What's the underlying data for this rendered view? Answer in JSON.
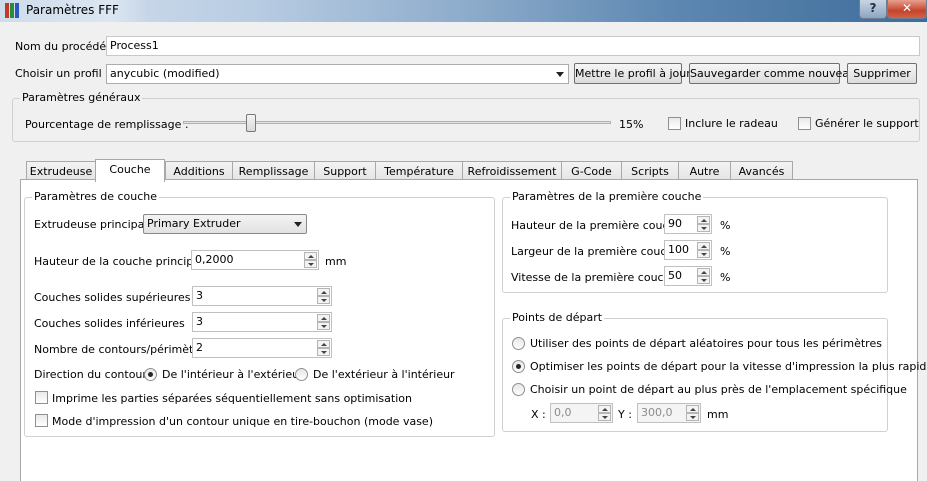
{
  "window": {
    "title": "Paramètres FFF",
    "help_label": "?",
    "close_label": "✕"
  },
  "process": {
    "label": "Nom du procédé :",
    "value": "Process1"
  },
  "profile": {
    "label": "Choisir un profil :",
    "selected": "anycubic (modified)",
    "update_button": "Mettre le profil à jour",
    "save_new_button": "Sauvegarder comme nouveau",
    "delete_button": "Supprimer"
  },
  "general": {
    "title": "Paramètres généraux",
    "infill_label": "Pourcentage de remplissage :",
    "infill_value": "15%",
    "infill_fraction": 0.15,
    "raft_label": "Inclure le radeau",
    "support_label": "Générer le support"
  },
  "tabs": [
    {
      "label": "Extrudeuse"
    },
    {
      "label": "Couche"
    },
    {
      "label": "Additions"
    },
    {
      "label": "Remplissage"
    },
    {
      "label": "Support"
    },
    {
      "label": "Température"
    },
    {
      "label": "Refroidissement"
    },
    {
      "label": "G-Code"
    },
    {
      "label": "Scripts"
    },
    {
      "label": "Autre"
    },
    {
      "label": "Avancés"
    }
  ],
  "active_tab": "Couche",
  "layer": {
    "title": "Paramètres de couche",
    "primary_extruder_label": "Extrudeuse principale",
    "primary_extruder_value": "Primary Extruder",
    "layer_height_label": "Hauteur de la couche principale",
    "layer_height_value": "0,2000",
    "layer_height_unit": "mm",
    "top_layers_label": "Couches solides supérieures",
    "top_layers_value": "3",
    "bottom_layers_label": "Couches solides inférieures",
    "bottom_layers_value": "3",
    "perimeters_label": "Nombre de contours/périmètres",
    "perimeters_value": "2",
    "direction_label": "Direction du contour :",
    "direction_in_out": "De l'intérieur à l'extérieur",
    "direction_out_in": "De l'extérieur à l'intérieur",
    "sequential_label": "Imprime les parties séparées séquentiellement sans optimisation",
    "vase_label": "Mode d'impression d'un contour unique en tire-bouchon (mode vase)"
  },
  "first_layer": {
    "title": "Paramètres de la première couche",
    "height_label": "Hauteur de la première couche",
    "height_value": "90",
    "width_label": "Largeur de la première couche",
    "width_value": "100",
    "speed_label": "Vitesse de la première couche",
    "speed_value": "50",
    "unit": "%"
  },
  "start_points": {
    "title": "Points de départ",
    "random_label": "Utiliser des points de départ aléatoires pour tous les périmètres",
    "optimize_label": "Optimiser les points de départ pour la vitesse d'impression la plus rapide",
    "specific_label": "Choisir un point de départ au plus près de l'emplacement spécifique",
    "x_label": "X :",
    "x_value": "0,0",
    "y_label": "Y :",
    "y_value": "300,0",
    "unit": "mm"
  },
  "colors": {
    "icon_red": "#c0392b",
    "icon_green": "#2e8b3a",
    "icon_blue": "#2b57c0",
    "close_red": "#c4442b"
  }
}
